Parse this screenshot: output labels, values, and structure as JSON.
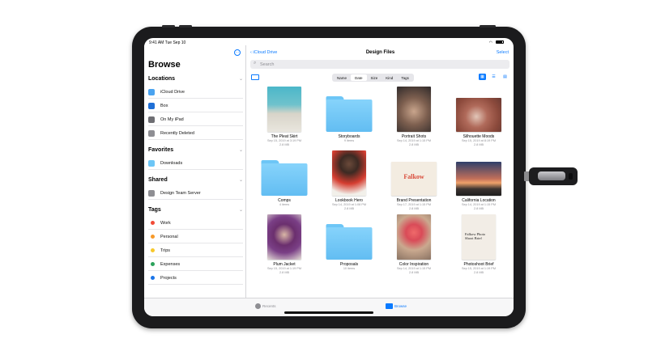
{
  "status": {
    "time": "9:41 AM Tue Sep 10",
    "wifi": "100%"
  },
  "sidebar": {
    "title": "Browse",
    "more": "···",
    "sections": {
      "locations": "Locations",
      "favorites": "Favorites",
      "shared": "Shared",
      "tags": "Tags"
    },
    "locations": [
      {
        "label": "iCloud Drive",
        "icon": "cloud-icon",
        "color": "#4aa3f0"
      },
      {
        "label": "Box",
        "icon": "box-icon",
        "color": "#1f6fd6"
      },
      {
        "label": "On My iPad",
        "icon": "ipad-icon",
        "color": "#6e6e73"
      },
      {
        "label": "Recently Deleted",
        "icon": "trash-icon",
        "color": "#8e8e93"
      }
    ],
    "favorites": [
      {
        "label": "Downloads",
        "icon": "downloads-folder-icon",
        "color": "#6dc6f6"
      }
    ],
    "shared": [
      {
        "label": "Design Team Server",
        "icon": "server-icon",
        "color": "#8e8e93"
      }
    ],
    "tags": [
      {
        "label": "Work",
        "color": "#f14b37"
      },
      {
        "label": "Personal",
        "color": "#f79a2a"
      },
      {
        "label": "Trips",
        "color": "#f7c82b"
      },
      {
        "label": "Expenses",
        "color": "#2ba25b"
      },
      {
        "label": "Projects",
        "color": "#1a74e8"
      }
    ]
  },
  "main": {
    "back": "iCloud Drive",
    "title": "Design Files",
    "select": "Select",
    "search_placeholder": "Search",
    "sort": [
      "Name",
      "Date",
      "Size",
      "Kind",
      "Tags"
    ],
    "sort_selected": "Date",
    "items": [
      {
        "name": "The Pleat Skirt",
        "meta1": "Sep 15, 2019 at 3:19 PM",
        "meta2": "2.8 MB",
        "kind": "photo"
      },
      {
        "name": "Storyboards",
        "meta1": "9 items",
        "meta2": "",
        "kind": "folder"
      },
      {
        "name": "Portrait Shots",
        "meta1": "Sep 14, 2019 at 1:15 PM",
        "meta2": "2.8 MB",
        "kind": "photo"
      },
      {
        "name": "Silhouette Moods",
        "meta1": "Sep 15, 2019 at 8:19 PM",
        "meta2": "2.8 MB",
        "kind": "photo"
      },
      {
        "name": "Comps",
        "meta1": "4 items",
        "meta2": "",
        "kind": "folder"
      },
      {
        "name": "Lookbook Hero",
        "meta1": "Sep 14, 2019 at 1:08 PM",
        "meta2": "2.8 MB",
        "kind": "photo"
      },
      {
        "name": "Brand Presentation",
        "meta1": "Sep 17, 2019 at 1:15 PM",
        "meta2": "2.8 MB",
        "kind": "doc",
        "doc_text": "Falkow"
      },
      {
        "name": "California Location",
        "meta1": "Sep 14, 2019 at 1:15 PM",
        "meta2": "2.8 MB",
        "kind": "photo"
      },
      {
        "name": "Plum Jacket",
        "meta1": "Sep 15, 2019 at 1:19 PM",
        "meta2": "2.8 MB",
        "kind": "photo"
      },
      {
        "name": "Proposals",
        "meta1": "10 items",
        "meta2": "",
        "kind": "folder"
      },
      {
        "name": "Color Inspiration",
        "meta1": "Sep 14, 2019 at 1:15 PM",
        "meta2": "2.8 MB",
        "kind": "photo"
      },
      {
        "name": "Photoshoot Brief",
        "meta1": "Sep 15, 2019 at 1:19 PM",
        "meta2": "2.8 MB",
        "kind": "doc",
        "doc_text": "Falkow Photo Shoot Brief"
      }
    ]
  },
  "tabbar": {
    "recents": "Recents",
    "browse": "Browse"
  }
}
